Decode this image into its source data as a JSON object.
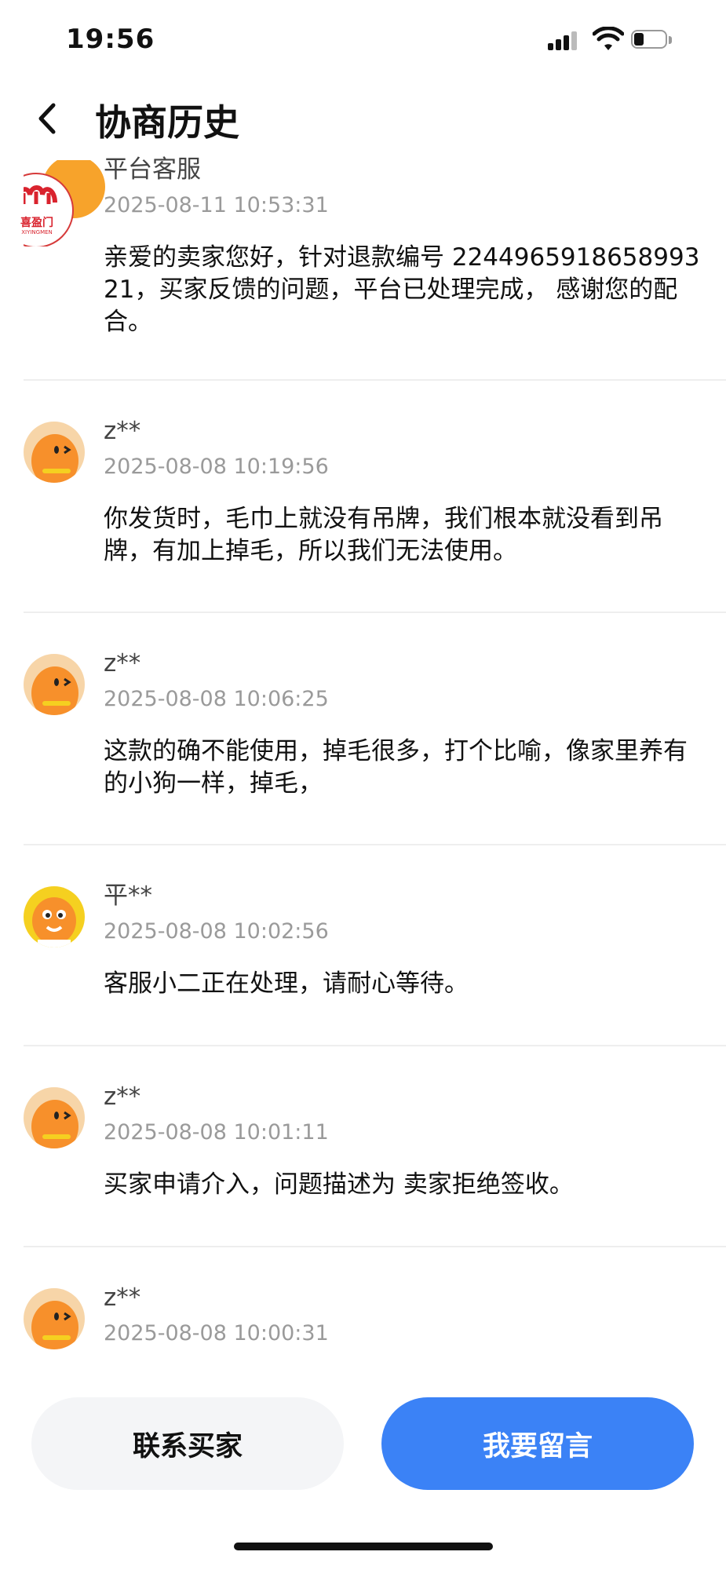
{
  "status_bar": {
    "time": "19:56"
  },
  "nav": {
    "title": "协商历史"
  },
  "entries": [
    {
      "name": "平台客服",
      "time": "2025-08-11 10:53:31",
      "message": "亲爱的卖家您好，针对退款编号 224496591865899321，买家反馈的问题，平台已处理完成， 感谢您的配合。",
      "avatar_logo_text": "喜盈门",
      "avatar_logo_sub": "XIYINGMEN"
    },
    {
      "name": "z**",
      "time": "2025-08-08 10:19:56",
      "message": "你发货时，毛巾上就没有吊牌，我们根本就没看到吊牌，有加上掉毛，所以我们无法使用。"
    },
    {
      "name": "z**",
      "time": "2025-08-08 10:06:25",
      "message": "这款的确不能使用，掉毛很多，打个比喻，像家里养有的小狗一样，掉毛，"
    },
    {
      "name": "平**",
      "time": "2025-08-08 10:02:56",
      "message": "客服小二正在处理，请耐心等待。"
    },
    {
      "name": "z**",
      "time": "2025-08-08 10:01:11",
      "message": "买家申请介入，问题描述为 卖家拒绝签收。"
    },
    {
      "name": "z**",
      "time": "2025-08-08 10:00:31",
      "message": ""
    }
  ],
  "buttons": {
    "contact_buyer": "联系买家",
    "leave_message": "我要留言"
  },
  "colors": {
    "primary": "#3b82f6",
    "avatar_orange": "#f7a32b",
    "divider": "#eeeeee"
  }
}
